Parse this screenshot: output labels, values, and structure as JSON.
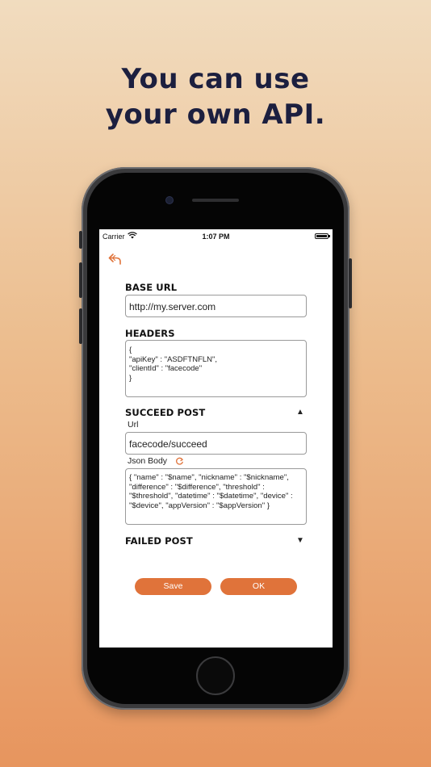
{
  "headline": [
    "You can use",
    "your own API."
  ],
  "status_bar": {
    "carrier": "Carrier",
    "time": "1:07 PM"
  },
  "base_url": {
    "label": "BASE URL",
    "value": "http://my.server.com"
  },
  "headers": {
    "label": "HEADERS",
    "value": "{\n\"apiKey\" : \"ASDFTNFLN\",\n\"clientId\" : \"facecode\"\n}"
  },
  "succeed_post": {
    "label": "SUCCEED POST",
    "toggle": "▲",
    "url_label": "Url",
    "url_value": "facecode/succeed",
    "json_label": "Json Body",
    "json_value": "{ \"name\" : \"$name\", \"nickname\" : \"$nickname\", \"difference\" : \"$difference\", \"threshold\" : \"$threshold\", \"datetime\" : \"$datetime\", \"device\" : \"$device\", \"appVersion\" : \"$appVersion\" }"
  },
  "failed_post": {
    "label": "FAILED POST",
    "toggle": "▼"
  },
  "buttons": {
    "save": "Save",
    "ok": "OK"
  },
  "colors": {
    "accent": "#e0733a",
    "headline": "#1c1f3f"
  },
  "icons": {
    "back": "back-arrow-icon",
    "refresh": "refresh-icon",
    "wifi": "wifi-icon",
    "battery": "battery-icon"
  }
}
